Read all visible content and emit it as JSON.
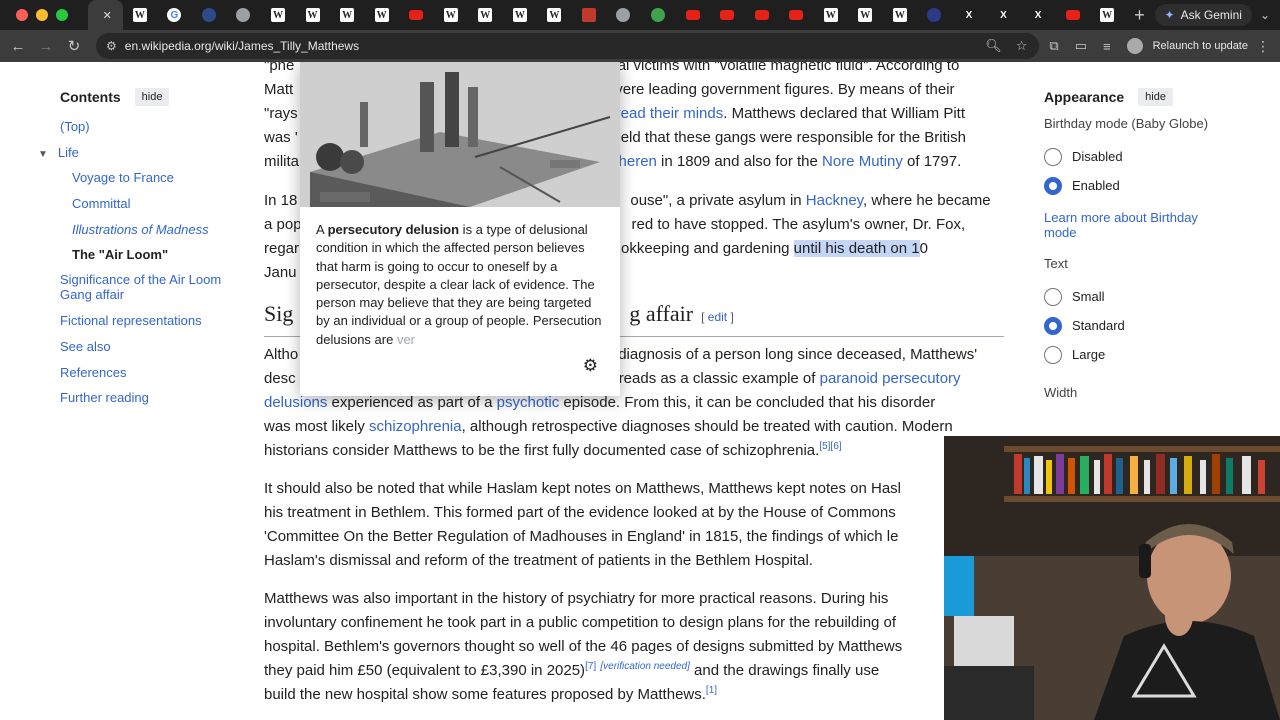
{
  "browser": {
    "url": "en.wikipedia.org/wiki/James_Tilly_Matthews",
    "gemini_label": "Ask Gemini",
    "relaunch_label": "Relaunch to update",
    "tabs": [
      {
        "icon": "wikipedia-favicon",
        "letter": "W",
        "color": "#ffffff",
        "active": true
      },
      {
        "icon": "wikipedia-favicon",
        "letter": "W",
        "color": "#ffffff"
      },
      {
        "icon": "google-favicon",
        "letter": "G",
        "color": "#ffffff"
      },
      {
        "icon": "dark-favicon",
        "letter": "",
        "color": "#2d4a8a"
      },
      {
        "icon": "globe-favicon",
        "letter": "",
        "color": "#9aa0a6"
      },
      {
        "icon": "wikipedia-favicon",
        "letter": "W",
        "color": "#ffffff"
      },
      {
        "icon": "wikipedia-favicon",
        "letter": "W",
        "color": "#ffffff"
      },
      {
        "icon": "wikipedia-favicon",
        "letter": "W",
        "color": "#ffffff"
      },
      {
        "icon": "wikipedia-favicon",
        "letter": "W",
        "color": "#ffffff"
      },
      {
        "icon": "youtube-favicon",
        "letter": "",
        "color": "#e62117"
      },
      {
        "icon": "wikipedia-favicon",
        "letter": "W",
        "color": "#ffffff"
      },
      {
        "icon": "wikipedia-favicon",
        "letter": "W",
        "color": "#ffffff"
      },
      {
        "icon": "wikipedia-favicon",
        "letter": "W",
        "color": "#ffffff"
      },
      {
        "icon": "wikipedia-favicon",
        "letter": "W",
        "color": "#ffffff"
      },
      {
        "icon": "red-favicon",
        "letter": "",
        "color": "#c0392b"
      },
      {
        "icon": "globe-favicon",
        "letter": "",
        "color": "#9aa0a6"
      },
      {
        "icon": "green-favicon",
        "letter": "",
        "color": "#3ea34b"
      },
      {
        "icon": "youtube-favicon",
        "letter": "",
        "color": "#e62117"
      },
      {
        "icon": "youtube-favicon",
        "letter": "",
        "color": "#e62117"
      },
      {
        "icon": "youtube-favicon",
        "letter": "",
        "color": "#e62117"
      },
      {
        "icon": "youtube-favicon",
        "letter": "",
        "color": "#e62117"
      },
      {
        "icon": "wikipedia-favicon",
        "letter": "W",
        "color": "#ffffff"
      },
      {
        "icon": "wikipedia-favicon",
        "letter": "W",
        "color": "#ffffff"
      },
      {
        "icon": "wikipedia-favicon",
        "letter": "W",
        "color": "#ffffff"
      },
      {
        "icon": "dark-favicon",
        "letter": "",
        "color": "#2d3a8a"
      },
      {
        "icon": "x-favicon",
        "letter": "X",
        "color": "#ffffff"
      },
      {
        "icon": "x-favicon",
        "letter": "X",
        "color": "#ffffff"
      },
      {
        "icon": "x-favicon",
        "letter": "X",
        "color": "#ffffff"
      },
      {
        "icon": "youtube-favicon",
        "letter": "",
        "color": "#e62117"
      },
      {
        "icon": "wikipedia-favicon",
        "letter": "W",
        "color": "#ffffff"
      }
    ]
  },
  "toc": {
    "title": "Contents",
    "hide": "hide",
    "items": [
      {
        "label": "(Top)",
        "level": 1
      },
      {
        "label": "Life",
        "level": 1,
        "expanded": true
      },
      {
        "label": "Voyage to France",
        "level": 2
      },
      {
        "label": "Committal",
        "level": 2
      },
      {
        "label": "Illustrations of Madness",
        "level": 2,
        "italic": true
      },
      {
        "label": "The \"Air Loom\"",
        "level": 2,
        "current": true
      },
      {
        "label": "Significance of the Air Loom Gang affair",
        "level": 1,
        "two_line": true
      },
      {
        "label": "Fictional representations",
        "level": 1
      },
      {
        "label": "See also",
        "level": 1
      },
      {
        "label": "References",
        "level": 1
      },
      {
        "label": "Further reading",
        "level": 1
      }
    ]
  },
  "article": {
    "p1": {
      "l1a": "\"pne",
      "l1b": "ial victims with \"volatile magnetic fluid\". According to",
      "l2a": "Matt",
      "l2b": "vere leading government figures. By means of their",
      "l3a": "\"rays",
      "l3link": "read their minds",
      "l3b": ". Matthews declared that William Pitt",
      "l4a": "was '",
      "l4b": "eld that these gangs were responsible for the British",
      "l5a": "milita",
      "l5link1": "cheren",
      "l5b": " in 1809 and also for the ",
      "l5link2": "Nore Mutiny",
      "l5c": " of 1797."
    },
    "p2": {
      "l1a": "In 18",
      "l1b": "ouse\", a private asylum in ",
      "l1link": "Hackney",
      "l1c": ", where he became",
      "l2a": "a pop",
      "l2b": "red to have stopped. The asylum's owner, Dr. Fox,",
      "l3a": "regar",
      "l3b": "okkeeping and gardening ",
      "l3hl": "until his death on 1",
      "l3c": "0",
      "l4a": "Janu"
    },
    "h2a": "Sig",
    "h2b": "g affair",
    "edit_open": "[ ",
    "edit": "edit",
    "edit_close": " ]",
    "p3": {
      "l1a": "Altho",
      "l1b": "diagnosis of a person long since deceased, Matthews'",
      "l2a": "desc",
      "l2b": "reads as a classic example of ",
      "l2link": "paranoid persecutory",
      "l3link1": "delusions",
      "l3b": " experienced as part of a ",
      "l3link2": "psychotic",
      "l3c": " episode. From this, it can be concluded that his disorder",
      "l4a": "was most likely ",
      "l4link": "schizophrenia",
      "l4b": ", although retrospective diagnoses should be treated with caution. Modern",
      "l5a": "historians consider Matthews to be the first fully documented case of schizophrenia.",
      "l5sup": "[5][6]"
    },
    "p4": {
      "l1": "It should also be noted that while Haslam kept notes on Matthews, Matthews kept notes on Hasl",
      "l2": "his treatment in Bethlem. This formed part of the evidence looked at by the House of Commons",
      "l3": "'Committee On the Better Regulation of Madhouses in England' in 1815, the findings of which le",
      "l4": "Haslam's dismissal and reform of the treatment of patients in the Bethlem Hospital."
    },
    "p5": {
      "l1": "Matthews was also important in the history of psychiatry for more practical reasons. During his",
      "l2": "involuntary confinement he took part in a public competition to design plans for the rebuilding of",
      "l3": "hospital. Bethlem's governors thought so well of the 46 pages of designs submitted by Matthews",
      "l4a": "they paid him £50 (equivalent to £3,390 in 2025)",
      "l4sup1": "[7]",
      "l4sup2": "[verification needed]",
      "l4b": " and the drawings finally use",
      "l5a": "build the new hospital show some features proposed by Matthews.",
      "l5sup": "[1]"
    }
  },
  "popup": {
    "text_a": "A ",
    "text_bold": "persecutory delusion",
    "text_b": " is a type of delusional condition in which the affected person believes that harm is going to occur to oneself by a persecutor, despite a clear lack of evidence. The person may believe that they are being targeted by an individual or a group of people. Persecution delusions are ",
    "text_fade": "ver"
  },
  "appearance": {
    "title": "Appearance",
    "hide": "hide",
    "birthday_label": "Birthday mode (Baby Globe)",
    "options_birthday": [
      {
        "label": "Disabled",
        "selected": false
      },
      {
        "label": "Enabled",
        "selected": true
      }
    ],
    "learn_more": "Learn more about Birthday mode",
    "text_label": "Text",
    "options_text": [
      {
        "label": "Small",
        "selected": false
      },
      {
        "label": "Standard",
        "selected": true
      },
      {
        "label": "Large",
        "selected": false
      }
    ],
    "width_label": "Width"
  },
  "colors": {
    "link": "#3366cc",
    "text": "#202122",
    "highlight": "#c5d6f4",
    "chrome_dark": "#1f1f1f",
    "chrome_mid": "#3c3c3c"
  }
}
